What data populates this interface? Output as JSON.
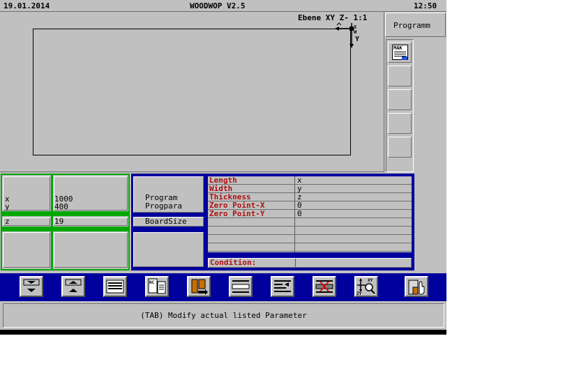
{
  "header": {
    "date": "19.01.2014",
    "title": "WOODWOP V2.5",
    "time": "12:50"
  },
  "view": {
    "plane_label": "Ebene XY Z- 1:1",
    "axis_x": "X",
    "axis_y": "Y",
    "axis_w": "W",
    "axis_z": "M"
  },
  "side": {
    "tab_label": "Programm",
    "mak_label": "MAK"
  },
  "left_panel": {
    "x_name": "x",
    "x_value": "1000",
    "y_name": "y",
    "y_value": "400",
    "z_name": "z",
    "z_value": "19"
  },
  "middle_panel": {
    "program": "Program",
    "progpara": "Progpara",
    "boardsize": "BoardSize"
  },
  "param_table": {
    "rows": [
      {
        "name": "Length",
        "value": "x"
      },
      {
        "name": "Width",
        "value": "y"
      },
      {
        "name": "Thickness",
        "value": "z"
      },
      {
        "name": "Zero Point-X",
        "value": "0"
      },
      {
        "name": "Zero Point-Y",
        "value": "0"
      },
      {
        "name": "",
        "value": ""
      },
      {
        "name": "",
        "value": ""
      },
      {
        "name": "",
        "value": ""
      },
      {
        "name": "",
        "value": ""
      }
    ],
    "condition_label": "Condition:",
    "condition_value": ""
  },
  "toolbar": {
    "buttons": [
      "scroll-down",
      "scroll-up",
      "list-view",
      "nc-program",
      "insert-macro",
      "edit-line",
      "sort-list",
      "delete",
      "zoom-view",
      "exit"
    ],
    "nc_label": "NC",
    "zoom_labels": {
      "xy": "XY",
      "zy": "ZY"
    }
  },
  "status": {
    "message": "(TAB) Modify actual listed Parameter"
  },
  "colors": {
    "panel_bg": "#c0c0c0",
    "blue": "#00009c",
    "green": "#00a800",
    "param_red": "#b01010"
  }
}
